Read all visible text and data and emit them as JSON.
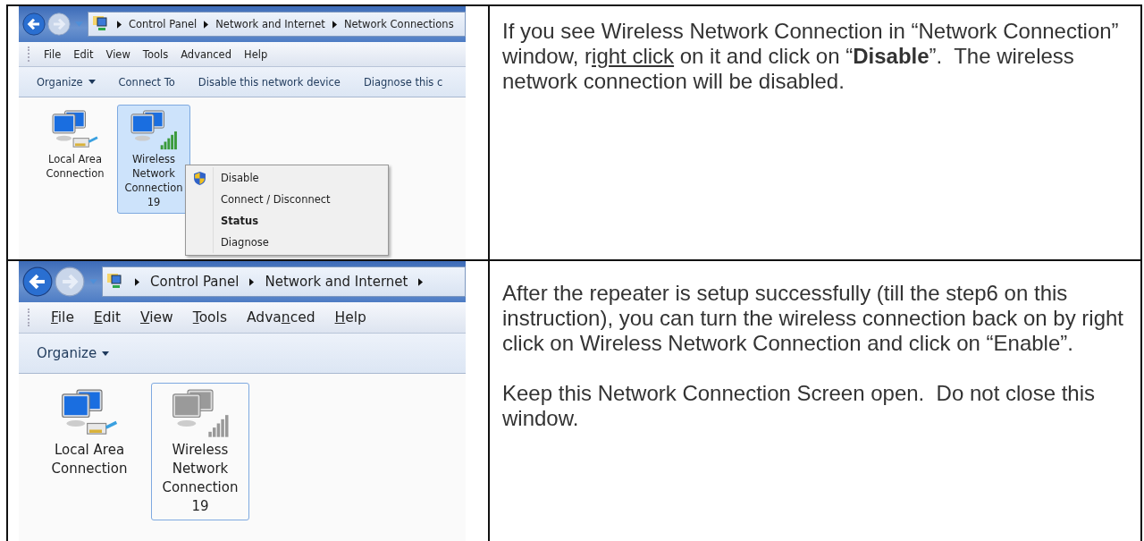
{
  "steps": [
    {
      "screenshot": {
        "focused": true,
        "breadcrumbs": [
          "Control Panel",
          "Network and Internet",
          "Network Connections"
        ],
        "menu": [
          {
            "after": "File"
          },
          {
            "after": "Edit"
          },
          {
            "after": "View"
          },
          {
            "after": "Tools"
          },
          {
            "after": "Advanced"
          },
          {
            "after": "Help"
          }
        ],
        "toolbar": [
          {
            "label": "Organize",
            "dropdown": true
          },
          {
            "label": "Connect To",
            "dropdown": false
          },
          {
            "label": "Disable this network device",
            "dropdown": false
          },
          {
            "label": "Diagnose this c",
            "dropdown": false
          }
        ],
        "items": [
          {
            "kind": "wired",
            "label": "Local Area Connection",
            "selected": false,
            "disabled": false
          },
          {
            "kind": "wireless",
            "label": "Wireless Network Connection 19",
            "selected": true,
            "disabled": false
          }
        ],
        "context_menu": [
          {
            "label": "Disable",
            "default": false,
            "shield": true
          },
          {
            "label": "Connect / Disconnect",
            "default": false,
            "shield": false
          },
          {
            "label": "Status",
            "default": true,
            "shield": false
          },
          {
            "label": "Diagnose",
            "default": false,
            "shield": false
          }
        ]
      },
      "paragraphs": [
        [
          {
            "kind": "plain",
            "text": "If you see Wireless Network Connection in “Network Connection” window, r"
          },
          {
            "kind": "underline",
            "text": "ight click"
          },
          {
            "kind": "plain",
            "text": " on it and click on “"
          },
          {
            "kind": "bold",
            "text": "Disable"
          },
          {
            "kind": "plain",
            "text": "”.  The wireless network connection will be disabled."
          }
        ]
      ]
    },
    {
      "screenshot": {
        "focused": false,
        "breadcrumbs": [
          "Control Panel",
          "Network and Internet"
        ],
        "menu": [
          {
            "key": "F",
            "after": "ile"
          },
          {
            "key": "E",
            "after": "dit"
          },
          {
            "key": "V",
            "after": "iew"
          },
          {
            "key": "T",
            "after": "ools"
          },
          {
            "before": "Adva",
            "key": "n",
            "after": "ced"
          },
          {
            "key": "H",
            "after": "elp"
          }
        ],
        "toolbar": [
          {
            "label": "Organize",
            "dropdown": true
          }
        ],
        "items": [
          {
            "kind": "wired",
            "label": "Local Area Connection",
            "selected": false,
            "disabled": false
          },
          {
            "kind": "wireless",
            "label": "Wireless Network Connection 19",
            "selected": true,
            "disabled": true
          }
        ]
      },
      "paragraphs": [
        [
          {
            "kind": "plain",
            "text": "After the repeater is setup successfully (till the step6 on this instruction), you can turn the wireless connection back on by right click on Wireless Network Connection and click on “Enable”."
          }
        ],
        [
          {
            "kind": "plain",
            "text": "Keep this Network Connection Screen open.  Do not close this window."
          }
        ]
      ]
    }
  ]
}
